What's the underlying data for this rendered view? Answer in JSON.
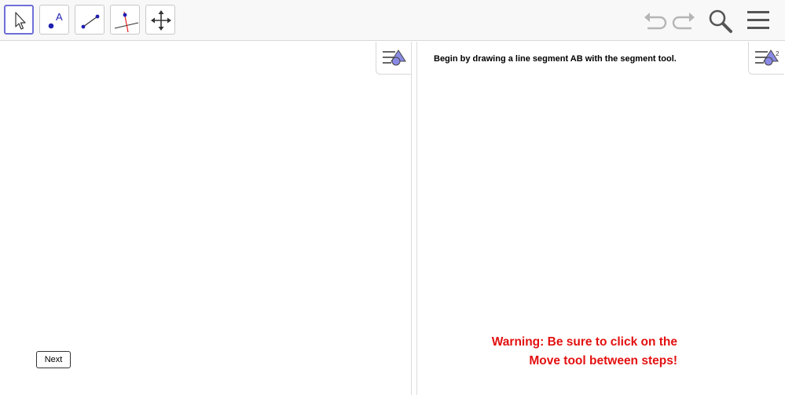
{
  "toolbar": {
    "tools": [
      {
        "name": "Move",
        "icon": "pointer-arrow-icon",
        "selected": true
      },
      {
        "name": "Point",
        "icon": "point-icon",
        "label": "A"
      },
      {
        "name": "Segment",
        "icon": "segment-icon"
      },
      {
        "name": "Perpendicular Line",
        "icon": "perpendicular-line-icon"
      },
      {
        "name": "Move Graphics View",
        "icon": "move-graphics-view-icon"
      }
    ],
    "right_icons": [
      "undo-icon",
      "redo-icon",
      "search-icon",
      "menu-icon"
    ]
  },
  "graphics_view_1": {
    "next_button_label": "Next"
  },
  "graphics_view_2": {
    "instruction": "Begin by drawing a line segment AB with the segment tool.",
    "warning_line1": "Warning: Be sure to click on the",
    "warning_line2": "Move tool between steps!",
    "style_bar_badge": "2"
  },
  "colors": {
    "accent": "#6f6fd8",
    "warning": "#e31010",
    "point": "#1f1fb0",
    "perpendicular": "#e31010"
  }
}
